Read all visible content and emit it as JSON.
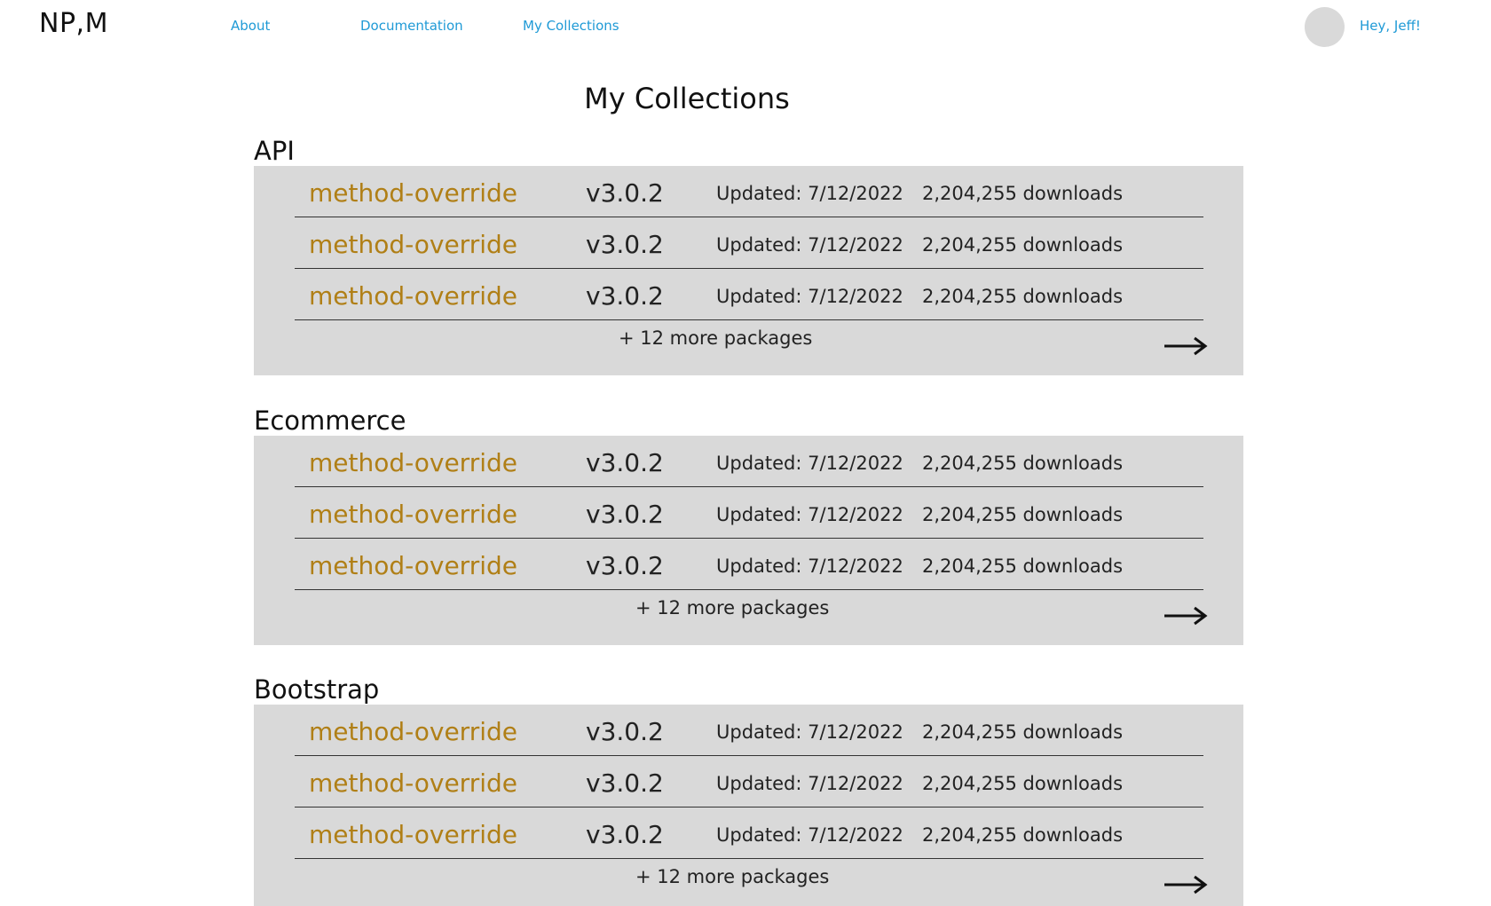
{
  "header": {
    "logo": "NP,M",
    "nav": {
      "about": "About",
      "documentation": "Documentation",
      "my_collections": "My Collections"
    },
    "greeting": "Hey, Jeff!"
  },
  "page_title": "My Collections",
  "colors": {
    "link_blue": "#1f9ad6",
    "package_name_gold": "#b07f16",
    "panel_gray": "#d9d9d9"
  },
  "collections": [
    {
      "name": "API",
      "packages": [
        {
          "name": "method-override",
          "version": "v3.0.2",
          "updated": "Updated: 7/12/2022",
          "downloads": "2,204,255 downloads"
        },
        {
          "name": "method-override",
          "version": "v3.0.2",
          "updated": "Updated: 7/12/2022",
          "downloads": "2,204,255 downloads"
        },
        {
          "name": "method-override",
          "version": "v3.0.2",
          "updated": "Updated: 7/12/2022",
          "downloads": "2,204,255 downloads"
        }
      ],
      "more_label": "+ 12 more packages",
      "arrow_icon": "arrow-right-icon"
    },
    {
      "name": "Ecommerce",
      "packages": [
        {
          "name": "method-override",
          "version": "v3.0.2",
          "updated": "Updated: 7/12/2022",
          "downloads": "2,204,255 downloads"
        },
        {
          "name": "method-override",
          "version": "v3.0.2",
          "updated": "Updated: 7/12/2022",
          "downloads": "2,204,255 downloads"
        },
        {
          "name": "method-override",
          "version": "v3.0.2",
          "updated": "Updated: 7/12/2022",
          "downloads": "2,204,255 downloads"
        }
      ],
      "more_label": "+ 12 more packages",
      "arrow_icon": "arrow-right-icon"
    },
    {
      "name": "Bootstrap",
      "packages": [
        {
          "name": "method-override",
          "version": "v3.0.2",
          "updated": "Updated: 7/12/2022",
          "downloads": "2,204,255 downloads"
        },
        {
          "name": "method-override",
          "version": "v3.0.2",
          "updated": "Updated: 7/12/2022",
          "downloads": "2,204,255 downloads"
        },
        {
          "name": "method-override",
          "version": "v3.0.2",
          "updated": "Updated: 7/12/2022",
          "downloads": "2,204,255 downloads"
        }
      ],
      "more_label": "+ 12 more packages",
      "arrow_icon": "arrow-right-icon"
    }
  ]
}
